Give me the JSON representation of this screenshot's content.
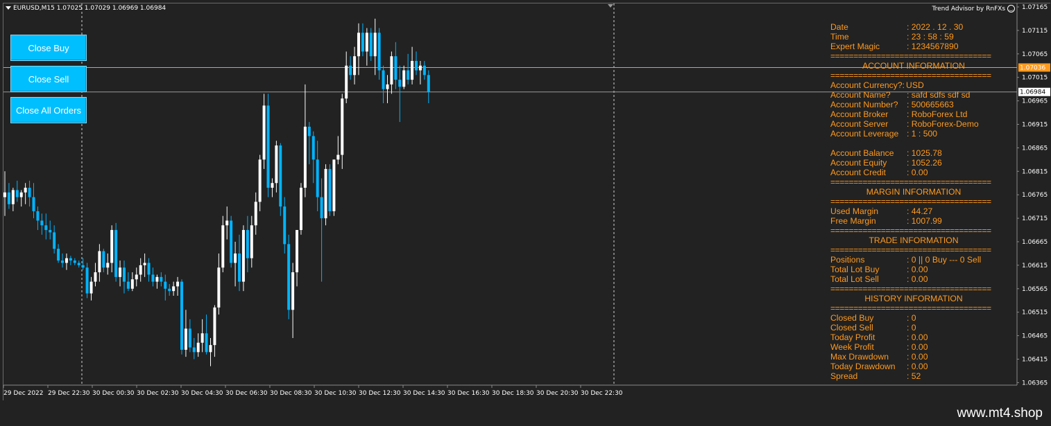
{
  "chart": {
    "title": "EURUSD,M15  1.07025 1.07029 1.06969 1.06984",
    "advisor": "Trend Advisor by RnFXs",
    "colors": {
      "bull": "#ffffff",
      "bear": "#00b4ff",
      "bid_line": "#ff9a1f",
      "price_line": "#9a9a9a",
      "grid": "#ffffff",
      "background": "#222222"
    },
    "price_axis": {
      "labels": [
        "1.07165",
        "1.07115",
        "1.07065",
        "1.07015",
        "1.06965",
        "1.06915",
        "1.06865",
        "1.06815",
        "1.06765",
        "1.06715",
        "1.06665",
        "1.06615",
        "1.06565",
        "1.06515",
        "1.06465",
        "1.06415",
        "1.06365"
      ],
      "bid_price": "1.07036",
      "current_price": "1.06984"
    },
    "time_axis": {
      "labels": [
        "29 Dec 2022",
        "29 Dec 22:30",
        "30 Dec 00:30",
        "30 Dec 02:30",
        "30 Dec 04:30",
        "30 Dec 06:30",
        "30 Dec 08:30",
        "30 Dec 10:30",
        "30 Dec 12:30",
        "30 Dec 14:30",
        "30 Dec 16:30",
        "30 Dec 18:30",
        "30 Dec 20:30",
        "30 Dec 22:30"
      ]
    }
  },
  "chart_data": {
    "type": "candlestick",
    "symbol": "EURUSD",
    "timeframe": "M15",
    "ylim": [
      1.0636,
      1.0717
    ],
    "series": [
      {
        "open": 1.0676,
        "high": 1.06815,
        "low": 1.0672,
        "close": 1.0677
      },
      {
        "open": 1.0677,
        "high": 1.0679,
        "low": 1.06735,
        "close": 1.06745
      },
      {
        "open": 1.06745,
        "high": 1.0678,
        "low": 1.0673,
        "close": 1.06775
      },
      {
        "open": 1.06775,
        "high": 1.06795,
        "low": 1.0675,
        "close": 1.0676
      },
      {
        "open": 1.0676,
        "high": 1.06775,
        "low": 1.0674,
        "close": 1.0677
      },
      {
        "open": 1.0677,
        "high": 1.0679,
        "low": 1.06745,
        "close": 1.0678
      },
      {
        "open": 1.0678,
        "high": 1.06795,
        "low": 1.0674,
        "close": 1.0676
      },
      {
        "open": 1.0676,
        "high": 1.0679,
        "low": 1.06715,
        "close": 1.0673
      },
      {
        "open": 1.0673,
        "high": 1.0674,
        "low": 1.0669,
        "close": 1.0671
      },
      {
        "open": 1.0671,
        "high": 1.06725,
        "low": 1.0668,
        "close": 1.067
      },
      {
        "open": 1.067,
        "high": 1.06725,
        "low": 1.0667,
        "close": 1.0669
      },
      {
        "open": 1.0669,
        "high": 1.0671,
        "low": 1.0667,
        "close": 1.06685
      },
      {
        "open": 1.06685,
        "high": 1.067,
        "low": 1.0664,
        "close": 1.0665
      },
      {
        "open": 1.0665,
        "high": 1.0666,
        "low": 1.0662,
        "close": 1.06625
      },
      {
        "open": 1.06625,
        "high": 1.0664,
        "low": 1.0661,
        "close": 1.0662
      },
      {
        "open": 1.0662,
        "high": 1.0664,
        "low": 1.06605,
        "close": 1.0663
      },
      {
        "open": 1.0663,
        "high": 1.06635,
        "low": 1.06615,
        "close": 1.06625
      },
      {
        "open": 1.06625,
        "high": 1.0663,
        "low": 1.06615,
        "close": 1.0662
      },
      {
        "open": 1.0662,
        "high": 1.06625,
        "low": 1.0661,
        "close": 1.06615
      },
      {
        "open": 1.06615,
        "high": 1.0663,
        "low": 1.06605,
        "close": 1.0661
      },
      {
        "open": 1.0661,
        "high": 1.0662,
        "low": 1.06545,
        "close": 1.06555
      },
      {
        "open": 1.06555,
        "high": 1.0659,
        "low": 1.0654,
        "close": 1.0658
      },
      {
        "open": 1.0658,
        "high": 1.0662,
        "low": 1.0657,
        "close": 1.066
      },
      {
        "open": 1.066,
        "high": 1.0666,
        "low": 1.0658,
        "close": 1.06645
      },
      {
        "open": 1.06645,
        "high": 1.0665,
        "low": 1.066,
        "close": 1.0661
      },
      {
        "open": 1.0661,
        "high": 1.0664,
        "low": 1.06595,
        "close": 1.0662
      },
      {
        "open": 1.0662,
        "high": 1.067,
        "low": 1.066,
        "close": 1.0669
      },
      {
        "open": 1.0669,
        "high": 1.06705,
        "low": 1.0658,
        "close": 1.0659
      },
      {
        "open": 1.0659,
        "high": 1.06625,
        "low": 1.0657,
        "close": 1.0661
      },
      {
        "open": 1.0661,
        "high": 1.06625,
        "low": 1.06555,
        "close": 1.0658
      },
      {
        "open": 1.0658,
        "high": 1.066,
        "low": 1.0656,
        "close": 1.06565
      },
      {
        "open": 1.06565,
        "high": 1.066,
        "low": 1.0656,
        "close": 1.06585
      },
      {
        "open": 1.06585,
        "high": 1.0661,
        "low": 1.0657,
        "close": 1.06595
      },
      {
        "open": 1.06595,
        "high": 1.0663,
        "low": 1.0658,
        "close": 1.06615
      },
      {
        "open": 1.06615,
        "high": 1.0664,
        "low": 1.0659,
        "close": 1.0662
      },
      {
        "open": 1.0662,
        "high": 1.0663,
        "low": 1.0658,
        "close": 1.06595
      },
      {
        "open": 1.06595,
        "high": 1.0661,
        "low": 1.0657,
        "close": 1.0658
      },
      {
        "open": 1.0658,
        "high": 1.06595,
        "low": 1.06565,
        "close": 1.0659
      },
      {
        "open": 1.0659,
        "high": 1.066,
        "low": 1.0657,
        "close": 1.0658
      },
      {
        "open": 1.0658,
        "high": 1.06595,
        "low": 1.0654,
        "close": 1.06565
      },
      {
        "open": 1.06565,
        "high": 1.06575,
        "low": 1.0655,
        "close": 1.0656
      },
      {
        "open": 1.0656,
        "high": 1.0658,
        "low": 1.0655,
        "close": 1.0657
      },
      {
        "open": 1.0657,
        "high": 1.0659,
        "low": 1.0655,
        "close": 1.0658
      },
      {
        "open": 1.0658,
        "high": 1.06585,
        "low": 1.06425,
        "close": 1.06435
      },
      {
        "open": 1.06435,
        "high": 1.0652,
        "low": 1.0642,
        "close": 1.0648
      },
      {
        "open": 1.0648,
        "high": 1.065,
        "low": 1.0643,
        "close": 1.0644
      },
      {
        "open": 1.0644,
        "high": 1.0646,
        "low": 1.06415,
        "close": 1.0643
      },
      {
        "open": 1.0643,
        "high": 1.0647,
        "low": 1.0642,
        "close": 1.0645
      },
      {
        "open": 1.0645,
        "high": 1.065,
        "low": 1.0643,
        "close": 1.0647
      },
      {
        "open": 1.0647,
        "high": 1.0651,
        "low": 1.06425,
        "close": 1.0643
      },
      {
        "open": 1.0643,
        "high": 1.0646,
        "low": 1.064,
        "close": 1.06445
      },
      {
        "open": 1.06445,
        "high": 1.0653,
        "low": 1.0642,
        "close": 1.06525
      },
      {
        "open": 1.06525,
        "high": 1.0664,
        "low": 1.0651,
        "close": 1.0661
      },
      {
        "open": 1.0661,
        "high": 1.0672,
        "low": 1.066,
        "close": 1.067
      },
      {
        "open": 1.067,
        "high": 1.0674,
        "low": 1.0667,
        "close": 1.0671
      },
      {
        "open": 1.0671,
        "high": 1.0672,
        "low": 1.0661,
        "close": 1.0662
      },
      {
        "open": 1.0662,
        "high": 1.06665,
        "low": 1.0657,
        "close": 1.0664
      },
      {
        "open": 1.0664,
        "high": 1.0668,
        "low": 1.0656,
        "close": 1.0658
      },
      {
        "open": 1.0658,
        "high": 1.067,
        "low": 1.0656,
        "close": 1.0669
      },
      {
        "open": 1.0669,
        "high": 1.0672,
        "low": 1.066,
        "close": 1.0663
      },
      {
        "open": 1.0663,
        "high": 1.0672,
        "low": 1.0661,
        "close": 1.067
      },
      {
        "open": 1.067,
        "high": 1.0677,
        "low": 1.0668,
        "close": 1.0675
      },
      {
        "open": 1.0675,
        "high": 1.0685,
        "low": 1.0673,
        "close": 1.0684
      },
      {
        "open": 1.0684,
        "high": 1.0698,
        "low": 1.0682,
        "close": 1.06955
      },
      {
        "open": 1.06955,
        "high": 1.0698,
        "low": 1.0676,
        "close": 1.0678
      },
      {
        "open": 1.0678,
        "high": 1.068,
        "low": 1.0676,
        "close": 1.0679
      },
      {
        "open": 1.0679,
        "high": 1.0688,
        "low": 1.0677,
        "close": 1.0687
      },
      {
        "open": 1.0687,
        "high": 1.06875,
        "low": 1.0672,
        "close": 1.0674
      },
      {
        "open": 1.0674,
        "high": 1.0676,
        "low": 1.0664,
        "close": 1.0666
      },
      {
        "open": 1.0666,
        "high": 1.0668,
        "low": 1.065,
        "close": 1.0652
      },
      {
        "open": 1.0652,
        "high": 1.0662,
        "low": 1.0646,
        "close": 1.066
      },
      {
        "open": 1.066,
        "high": 1.0669,
        "low": 1.0657,
        "close": 1.0669
      },
      {
        "open": 1.0669,
        "high": 1.0679,
        "low": 1.0668,
        "close": 1.0678
      },
      {
        "open": 1.0678,
        "high": 1.07,
        "low": 1.0676,
        "close": 1.0691
      },
      {
        "open": 1.0691,
        "high": 1.0692,
        "low": 1.0683,
        "close": 1.0689
      },
      {
        "open": 1.0689,
        "high": 1.069,
        "low": 1.0679,
        "close": 1.0684
      },
      {
        "open": 1.0684,
        "high": 1.0688,
        "low": 1.0673,
        "close": 1.0676
      },
      {
        "open": 1.0676,
        "high": 1.068,
        "low": 1.0658,
        "close": 1.06715
      },
      {
        "open": 1.06715,
        "high": 1.0683,
        "low": 1.067,
        "close": 1.0682
      },
      {
        "open": 1.0682,
        "high": 1.0683,
        "low": 1.0672,
        "close": 1.0673
      },
      {
        "open": 1.0673,
        "high": 1.0684,
        "low": 1.0672,
        "close": 1.0684
      },
      {
        "open": 1.0684,
        "high": 1.0689,
        "low": 1.0683,
        "close": 1.0685
      },
      {
        "open": 1.0685,
        "high": 1.0698,
        "low": 1.0682,
        "close": 1.0697
      },
      {
        "open": 1.0697,
        "high": 1.0707,
        "low": 1.0696,
        "close": 1.0704
      },
      {
        "open": 1.0704,
        "high": 1.0706,
        "low": 1.0701,
        "close": 1.0702
      },
      {
        "open": 1.0702,
        "high": 1.0708,
        "low": 1.07,
        "close": 1.0706
      },
      {
        "open": 1.0706,
        "high": 1.0713,
        "low": 1.0702,
        "close": 1.0711
      },
      {
        "open": 1.0711,
        "high": 1.0713,
        "low": 1.0706,
        "close": 1.0707
      },
      {
        "open": 1.0707,
        "high": 1.0712,
        "low": 1.0704,
        "close": 1.0711
      },
      {
        "open": 1.0711,
        "high": 1.0712,
        "low": 1.0705,
        "close": 1.0706
      },
      {
        "open": 1.0706,
        "high": 1.0714,
        "low": 1.0702,
        "close": 1.0711
      },
      {
        "open": 1.0711,
        "high": 1.0712,
        "low": 1.0701,
        "close": 1.0703
      },
      {
        "open": 1.0703,
        "high": 1.0704,
        "low": 1.0696,
        "close": 1.0699
      },
      {
        "open": 1.0699,
        "high": 1.0702,
        "low": 1.0696,
        "close": 1.07
      },
      {
        "open": 1.07,
        "high": 1.0707,
        "low": 1.0698,
        "close": 1.0706
      },
      {
        "open": 1.0706,
        "high": 1.0709,
        "low": 1.0699,
        "close": 1.0701
      },
      {
        "open": 1.0701,
        "high": 1.0704,
        "low": 1.0692,
        "close": 1.06995
      },
      {
        "open": 1.06995,
        "high": 1.0704,
        "low": 1.0699,
        "close": 1.0703
      },
      {
        "open": 1.0703,
        "high": 1.07065,
        "low": 1.07,
        "close": 1.0701
      },
      {
        "open": 1.0701,
        "high": 1.0708,
        "low": 1.07,
        "close": 1.0705
      },
      {
        "open": 1.0705,
        "high": 1.0707,
        "low": 1.0702,
        "close": 1.0703
      },
      {
        "open": 1.0703,
        "high": 1.0705,
        "low": 1.07,
        "close": 1.0704
      },
      {
        "open": 1.0704,
        "high": 1.0705,
        "low": 1.0701,
        "close": 1.0702
      },
      {
        "open": 1.0702,
        "high": 1.0703,
        "low": 1.0696,
        "close": 1.06984
      }
    ]
  },
  "buttons": {
    "close_buy": "Close Buy",
    "close_sell": "Close Sell",
    "close_all": "Close All Orders"
  },
  "info": {
    "date": {
      "label": "Date",
      "value": ": 2022 . 12 . 30"
    },
    "time": {
      "label": "Time",
      "value": ": 23 : 58 : 59"
    },
    "magic": {
      "label": "Expert Magic",
      "value": ": 1234567890"
    },
    "separator": "===================================",
    "account_header": "ACCOUNT INFORMATION",
    "currency": {
      "label": "Account Currency?:",
      "value": "USD"
    },
    "name": {
      "label": "Account Name?",
      "value": ":  safd    sdfs sdf  sd"
    },
    "number": {
      "label": "Account Number?",
      "value": ": 500665663"
    },
    "broker": {
      "label": "Account Broker",
      "value": ":  RoboForex Ltd"
    },
    "server": {
      "label": "Account Server",
      "value": ":  RoboForex-Demo"
    },
    "leverage": {
      "label": "Account Leverage",
      "value": ": 1 : 500"
    },
    "balance": {
      "label": "Account Balance",
      "value": ":  1025.78"
    },
    "equity": {
      "label": "Account Equity",
      "value": ":  1052.26"
    },
    "credit": {
      "label": "Account Credit",
      "value": ":  0.00"
    },
    "margin_header": "MARGIN INFORMATION",
    "used_margin": {
      "label": "Used Margin",
      "value": ":  44.27"
    },
    "free_margin": {
      "label": "Free Margin",
      "value": ":  1007.99"
    },
    "trade_header": "TRADE INFORMATION",
    "positions": {
      "label": "Positions",
      "value": ":  0  ||  0 Buy --- 0 Sell"
    },
    "lot_buy": {
      "label": "Total Lot Buy",
      "value": ":  0.00"
    },
    "lot_sell": {
      "label": "Total Lot Sell",
      "value": ":  0.00"
    },
    "history_header": "HISTORY INFORMATION",
    "closed_buy": {
      "label": "Closed Buy",
      "value": ":  0"
    },
    "closed_sell": {
      "label": "Closed Sell",
      "value": ":  0"
    },
    "today_profit": {
      "label": "Today Profit",
      "value": ":  0.00"
    },
    "week_profit": {
      "label": "Week Profit",
      "value": ":  0.00"
    },
    "max_dd": {
      "label": "Max Drawdown",
      "value": ":  0.00"
    },
    "today_dd": {
      "label": "Today Drawdown",
      "value": ":  0.00"
    },
    "spread": {
      "label": "Spread",
      "value": ":  52"
    }
  },
  "watermark": "www.mt4.shop"
}
